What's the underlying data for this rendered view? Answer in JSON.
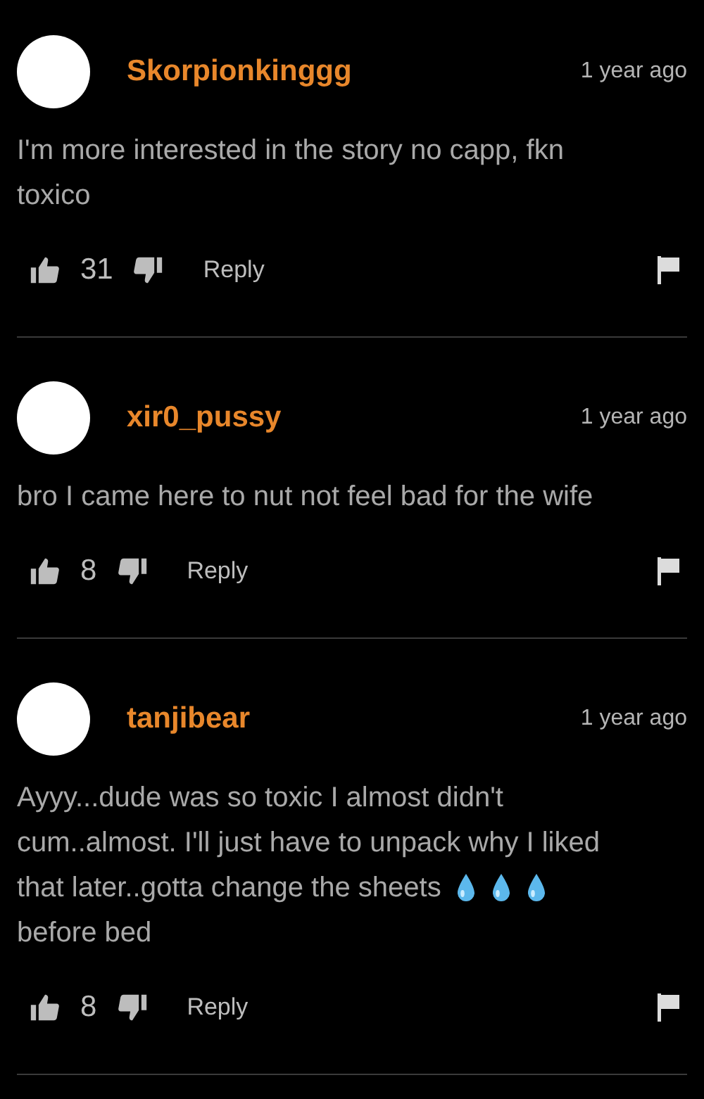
{
  "comments": [
    {
      "username": "Skorpionkinggg",
      "time": "1 year ago",
      "body": [
        [
          {
            "kind": "text",
            "text": "I'm more interested in the story no capp, fkn"
          }
        ],
        [
          {
            "kind": "text",
            "text": "toxico"
          }
        ]
      ],
      "likes": "31",
      "reply": "Reply"
    },
    {
      "username": "xir0_pussy",
      "time": "1 year ago",
      "body": [
        [
          {
            "kind": "text",
            "text": "bro I came here to nut not feel bad for the wife"
          }
        ]
      ],
      "likes": "8",
      "reply": "Reply"
    },
    {
      "username": "tanjibear",
      "time": "1 year ago",
      "body": [
        [
          {
            "kind": "text",
            "text": "Ayyy...dude was so toxic I almost didn't"
          }
        ],
        [
          {
            "kind": "text",
            "text": "cum..almost. I'll just have to unpack why I liked"
          }
        ],
        [
          {
            "kind": "text",
            "text": "that later..gotta change the sheets"
          },
          {
            "kind": "droplet"
          },
          {
            "kind": "droplet"
          },
          {
            "kind": "droplet"
          }
        ],
        [
          {
            "kind": "text",
            "text": "before bed"
          }
        ]
      ],
      "likes": "8",
      "reply": "Reply"
    }
  ]
}
